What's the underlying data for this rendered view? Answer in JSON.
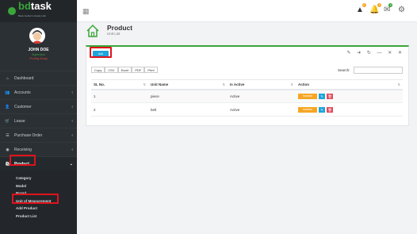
{
  "brand": {
    "name_part1": "bd",
    "name_part2": "task",
    "tagline": "Bank Auditor's Handy Hub"
  },
  "user": {
    "name": "JOHN DOE",
    "role": "Supervisor",
    "group": "Ps-Dhg Group"
  },
  "nav": [
    {
      "label": "Dashboard",
      "icon": "home-icon"
    },
    {
      "label": "Accounts",
      "icon": "people-icon"
    },
    {
      "label": "Customer",
      "icon": "person-icon"
    },
    {
      "label": "Lease",
      "icon": "cart-icon"
    },
    {
      "label": "Purchase Order",
      "icon": "list-icon"
    },
    {
      "label": "Receiving",
      "icon": "eye-icon"
    },
    {
      "label": "Product",
      "icon": "bag-icon"
    }
  ],
  "submenu": [
    "Category",
    "Model",
    "Brand",
    "Unit of Measurement",
    "Add Product",
    "Product List"
  ],
  "topbar": {
    "badges": [
      "0",
      "0",
      "0"
    ]
  },
  "page": {
    "title": "Product",
    "subtitle": "Unit List"
  },
  "card": {
    "add_label": "Add",
    "tools": "✎ ➜ ↻ — ✕ ✕",
    "exports": [
      "Copy",
      "CSV",
      "Excel",
      "PDF",
      "Print"
    ],
    "search_label": "Search:",
    "columns": [
      "SL No.",
      "Unit Name",
      "Is Active",
      "Action"
    ],
    "rows": [
      {
        "sl": "1",
        "name": "piece",
        "active": "Active",
        "status_btn": "Inactive"
      },
      {
        "sl": "2",
        "name": "belt",
        "active": "Active",
        "status_btn": "Inactive"
      }
    ]
  },
  "colors": {
    "accent": "#3aa63a",
    "sidebar": "#2b3035",
    "info": "#1fa4db",
    "warning": "#f6a623",
    "danger": "#e24d5c",
    "highlight": "#e0121b"
  }
}
